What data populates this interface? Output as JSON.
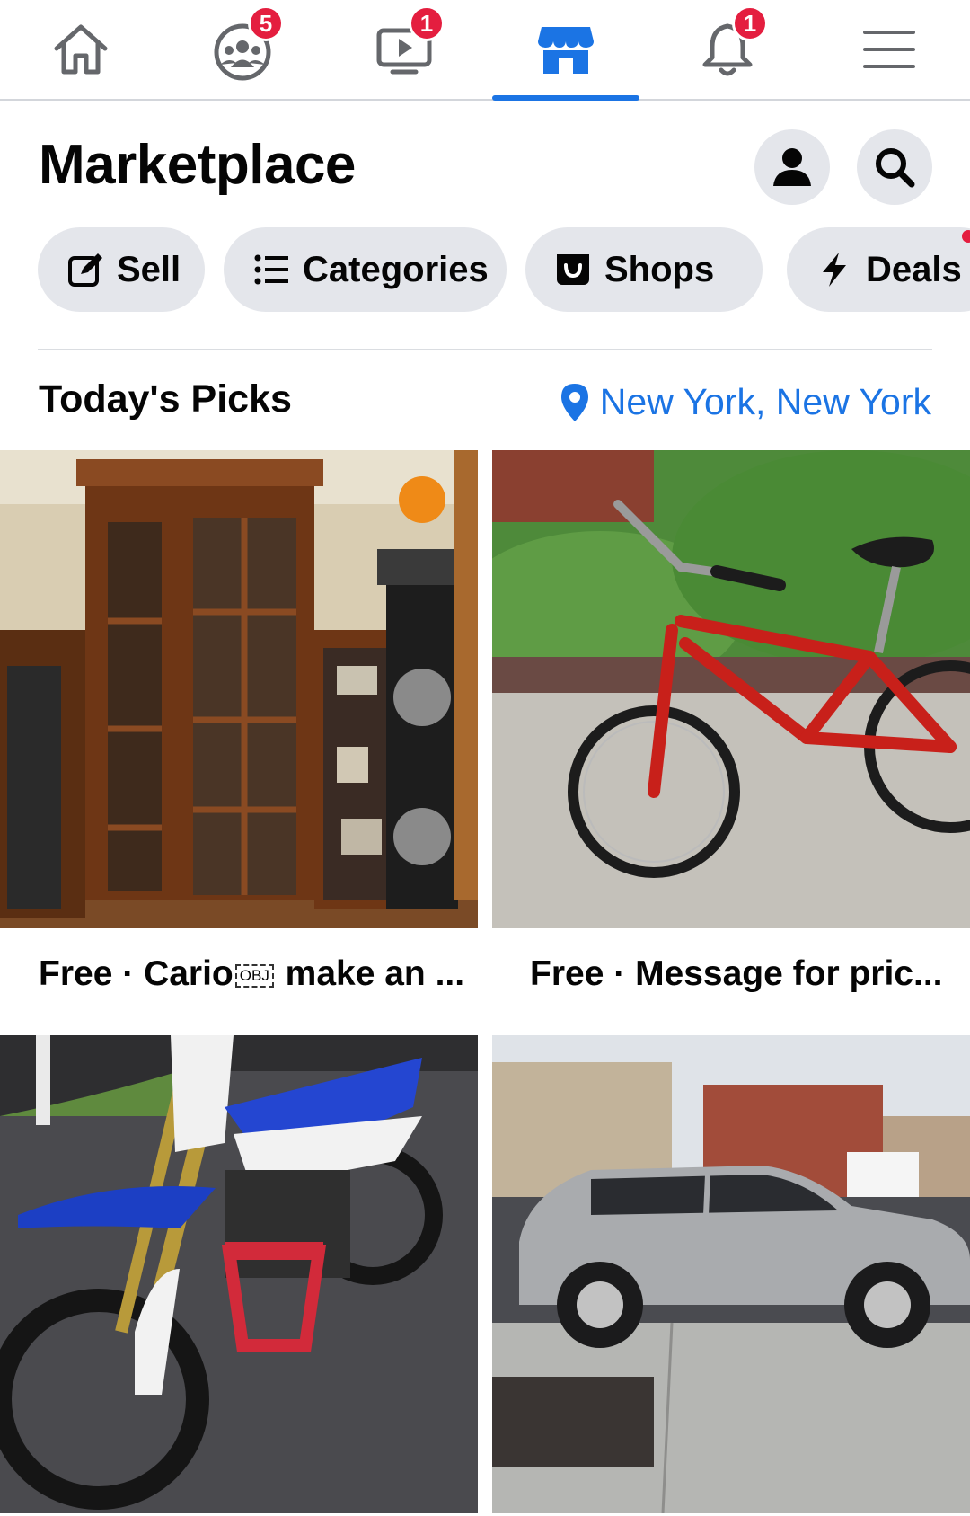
{
  "nav": {
    "items": [
      {
        "name": "home",
        "badge": ""
      },
      {
        "name": "groups",
        "badge": "5"
      },
      {
        "name": "watch",
        "badge": "1"
      },
      {
        "name": "marketplace",
        "badge": ""
      },
      {
        "name": "notifications",
        "badge": "1"
      },
      {
        "name": "menu",
        "badge": ""
      }
    ],
    "active": "marketplace"
  },
  "header": {
    "title": "Marketplace"
  },
  "chips": [
    {
      "label": "Sell",
      "icon": "edit-icon"
    },
    {
      "label": "Categories",
      "icon": "list-icon"
    },
    {
      "label": "Shops",
      "icon": "shopping-bag-icon"
    },
    {
      "label": "Deals",
      "icon": "lightning-icon"
    }
  ],
  "section": {
    "title": "Today's Picks",
    "location": "New York, New York"
  },
  "listings": [
    {
      "price": "Free",
      "sep": " · ",
      "title_pre": "Cario",
      "obj": "OBJ",
      "title_post": " make an ...",
      "image": "wooden-display-cabinet"
    },
    {
      "price": "Free",
      "sep": " · ",
      "title": "Message for pric...",
      "image": "red-bicycle"
    },
    {
      "image": "blue-dirt-bike"
    },
    {
      "image": "silver-suv"
    }
  ],
  "colors": {
    "accent": "#1b74e4",
    "badge": "#e41e3f",
    "chip_bg": "#e4e6eb"
  }
}
